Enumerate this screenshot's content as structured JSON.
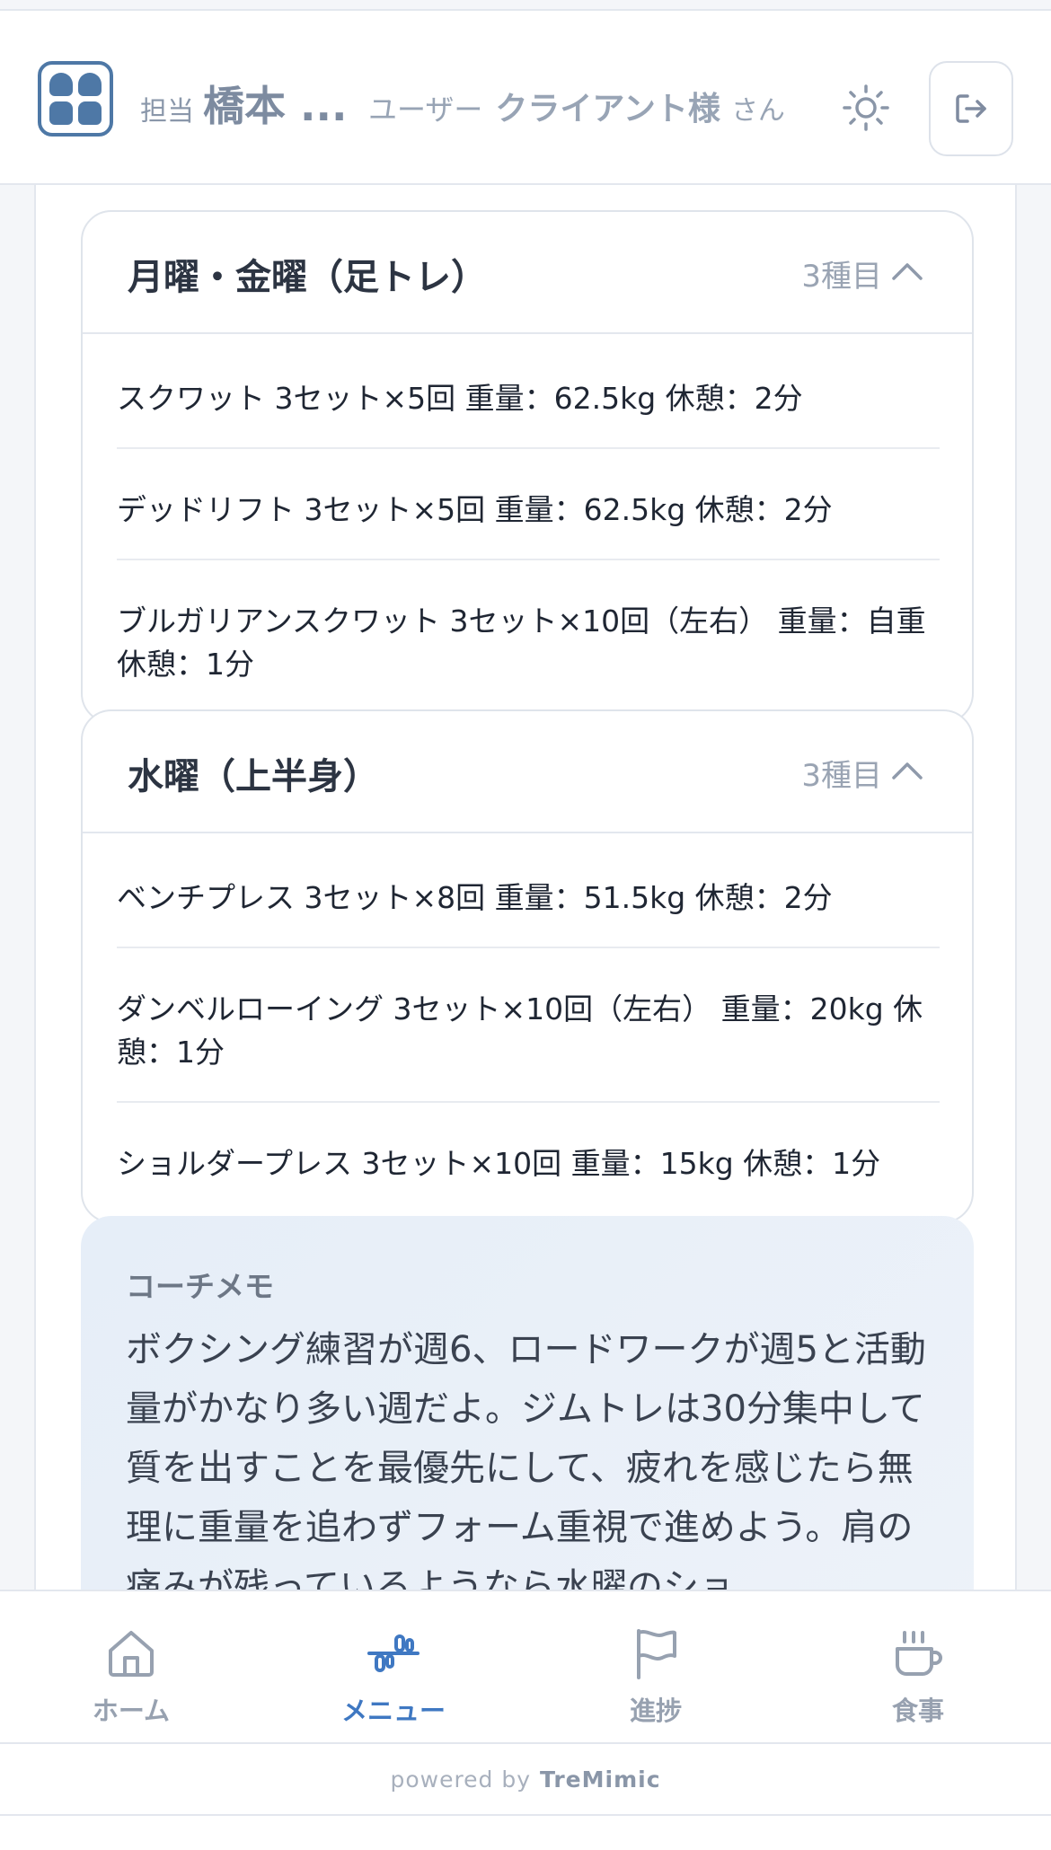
{
  "header": {
    "coach_label": "担当",
    "coach_name": "橋本 ...",
    "user_label": "ユーザー",
    "user_name": "クライアント様",
    "user_suffix": "さん"
  },
  "days": [
    {
      "title": "月曜・金曜（足トレ）",
      "count": "3種目",
      "exercises": [
        "スクワット 3セット×5回 重量：62.5kg 休憩：2分",
        "デッドリフト 3セット×5回 重量：62.5kg 休憩：2分",
        "ブルガリアンスクワット 3セット×10回（左右） 重量：自重 休憩：1分"
      ]
    },
    {
      "title": "水曜（上半身）",
      "count": "3種目",
      "exercises": [
        "ベンチプレス 3セット×8回 重量：51.5kg 休憩：2分",
        "ダンベルローイング 3セット×10回（左右） 重量：20kg 休憩：1分",
        "ショルダープレス 3セット×10回 重量：15kg 休憩：1分"
      ]
    }
  ],
  "memo": {
    "title": "コーチメモ",
    "text": "ボクシング練習が週6、ロードワークが週5と活動量がかなり多い週だよ。ジムトレは30分集中して質を出すことを最優先にして、疲れを感じたら無理に重量を追わずフォーム重視で進めよう。肩の痛みが残っているようなら水曜のショ"
  },
  "nav": {
    "home": "ホーム",
    "menu": "メニュー",
    "progress": "進捗",
    "meal": "食事",
    "active": "menu",
    "accent_color": "#3f78c2",
    "inactive_color": "#97a1b0"
  },
  "footer": {
    "powered_by": "powered by",
    "brand": "TreMimic"
  }
}
